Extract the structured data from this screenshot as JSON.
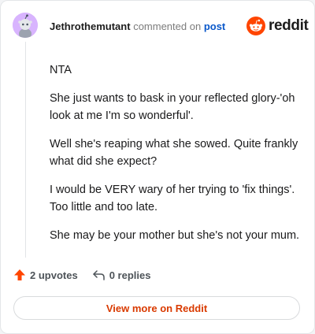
{
  "comment": {
    "username": "Jethrothemutant",
    "action_text": "commented on",
    "post_link": "post",
    "paragraphs": [
      "NTA",
      "She just wants to bask in your reflected glory-'oh look at me I'm so wonderful'.",
      "Well she's reaping what she sowed. Quite frankly what did she expect?",
      "I would be VERY wary of her trying to 'fix things'. Too little and too late.",
      "She may be your mother but she's not your mum."
    ]
  },
  "brand": {
    "name": "reddit",
    "icon": "reddit-logo-icon",
    "color": "#ff4500"
  },
  "actions": {
    "upvotes_label": "2 upvotes",
    "upvote_icon": "upvote-arrow-icon",
    "upvote_color": "#ff4500",
    "replies_label": "0 replies",
    "reply_icon": "reply-arrow-icon"
  },
  "footer": {
    "view_more_label": "View more on Reddit"
  }
}
